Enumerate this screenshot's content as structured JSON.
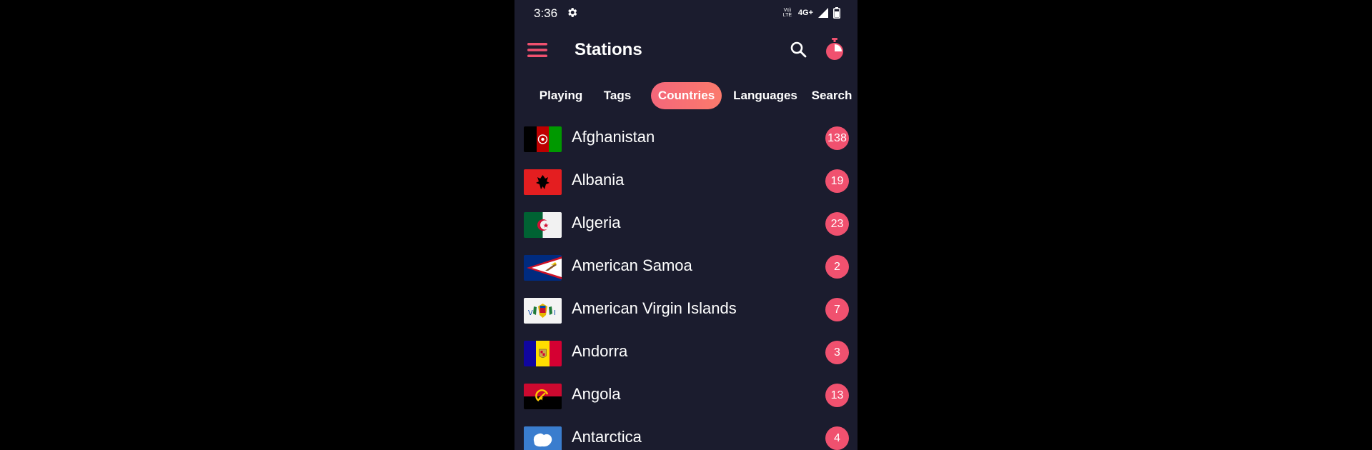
{
  "status_bar": {
    "time": "3:36",
    "volte_label": "Vo) LTE",
    "network_type": "4G+"
  },
  "app_bar": {
    "title": "Stations"
  },
  "tabs": [
    {
      "label": "Playing",
      "active": false
    },
    {
      "label": "Tags",
      "active": false
    },
    {
      "label": "Countries",
      "active": true
    },
    {
      "label": "Languages",
      "active": false
    },
    {
      "label": "Search",
      "active": false
    }
  ],
  "countries": [
    {
      "name": "Afghanistan",
      "count": "138",
      "flag": "afghanistan-flag"
    },
    {
      "name": "Albania",
      "count": "19",
      "flag": "albania-flag"
    },
    {
      "name": "Algeria",
      "count": "23",
      "flag": "algeria-flag"
    },
    {
      "name": "American Samoa",
      "count": "2",
      "flag": "american-samoa-flag"
    },
    {
      "name": "American Virgin Islands",
      "count": "7",
      "flag": "american-virgin-islands-flag"
    },
    {
      "name": "Andorra",
      "count": "3",
      "flag": "andorra-flag"
    },
    {
      "name": "Angola",
      "count": "13",
      "flag": "angola-flag"
    },
    {
      "name": "Antarctica",
      "count": "4",
      "flag": "antarctica-flag"
    }
  ],
  "colors": {
    "background": "#1b1c2e",
    "accent": "#f0516f",
    "accent_gradient_end": "#fb7a6c",
    "text": "#ffffff"
  }
}
